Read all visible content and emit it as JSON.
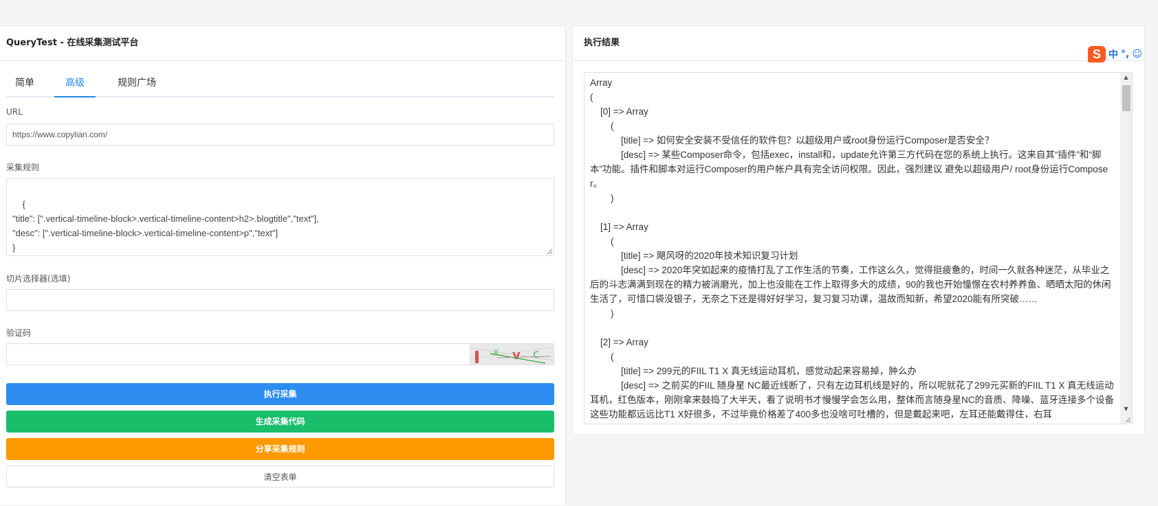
{
  "left_panel": {
    "title": "QueryTest - 在线采集测试平台",
    "tabs": [
      {
        "label": "简单",
        "active": false
      },
      {
        "label": "高级",
        "active": true
      },
      {
        "label": "规则广场",
        "active": false
      }
    ],
    "url_label": "URL",
    "url_value": "https://www.copylian.com/",
    "rules_label": "采集规则",
    "rules_value": "{\n\"title\": [\".vertical-timeline-block>.vertical-timeline-content>h2>.blogtitle\",\"text\"],\n\"desc\": [\".vertical-timeline-block>.vertical-timeline-content>p\",\"text\"]\n}",
    "slice_label": "切片选择器(选填)",
    "slice_value": "",
    "captcha_label": "验证码",
    "captcha_value": "",
    "buttons": {
      "execute": "执行采集",
      "generate": "生成采集代码",
      "share": "分享采集规则",
      "clear": "清空表单"
    }
  },
  "right_panel": {
    "title": "执行结果",
    "result": "Array\n(\n    [0] => Array\n        (\n            [title] => 如何安全安装不受信任的软件包？以超级用户或root身份运行Composer是否安全？\n            [desc] => 某些Composer命令，包括exec，install和，update允许第三方代码在您的系统上执行。这来自其“插件”和“脚本”功能。插件和脚本对运行Composer的用户帐户具有完全访问权限。因此，强烈建议 避免以超级用户/ root身份运行Composer。\n        )\n\n    [1] => Array\n        (\n            [title] => 飓风呀的2020年技术知识复习计划\n            [desc] => 2020年突如起来的疫情打乱了工作生活的节奏，工作这么久，觉得挺疲惫的，时间一久就各种迷茫，从毕业之后的斗志满满到现在的精力被消磨光，加上也没能在工作上取得多大的成绩，90的我也开始憧憬在农村养养鱼、晒晒太阳的休闲生活了，可惜口袋没银子，无奈之下还是得好好学习，复习复习功课，温故而知新，希望2020能有所突破……\n        )\n\n    [2] => Array\n        (\n            [title] => 299元的FIIL T1 X 真无线运动耳机，感觉动起来容易掉，肿么办\n            [desc] => 之前买的FIIL 随身星 NC最近线断了，只有左边耳机线是好的，所以呢就花了299元买新的FIIL T1 X 真无线运动耳机，红色版本，刚刚拿来鼓捣了大半天，看了说明书才慢慢学会怎么用，整体而言随身星NC的音质、降噪、蓝牙连接多个设备这些功能都远远比T1 X好很多，不过毕竟价格差了400多也没啥可吐槽的，但是戴起来吧，左耳还能戴得住，右耳"
  },
  "ime": {
    "logo": "S",
    "lang": "中",
    "punct": "°,",
    "emoji": "☺"
  },
  "colors": {
    "primary": "#2d8cf0",
    "success": "#19be6b",
    "warning": "#ff9900",
    "tab_active": "#1e88e5"
  },
  "icons": [
    "resize-grip-icon",
    "scroll-up-icon",
    "scroll-down-icon",
    "sogou-logo-icon"
  ]
}
